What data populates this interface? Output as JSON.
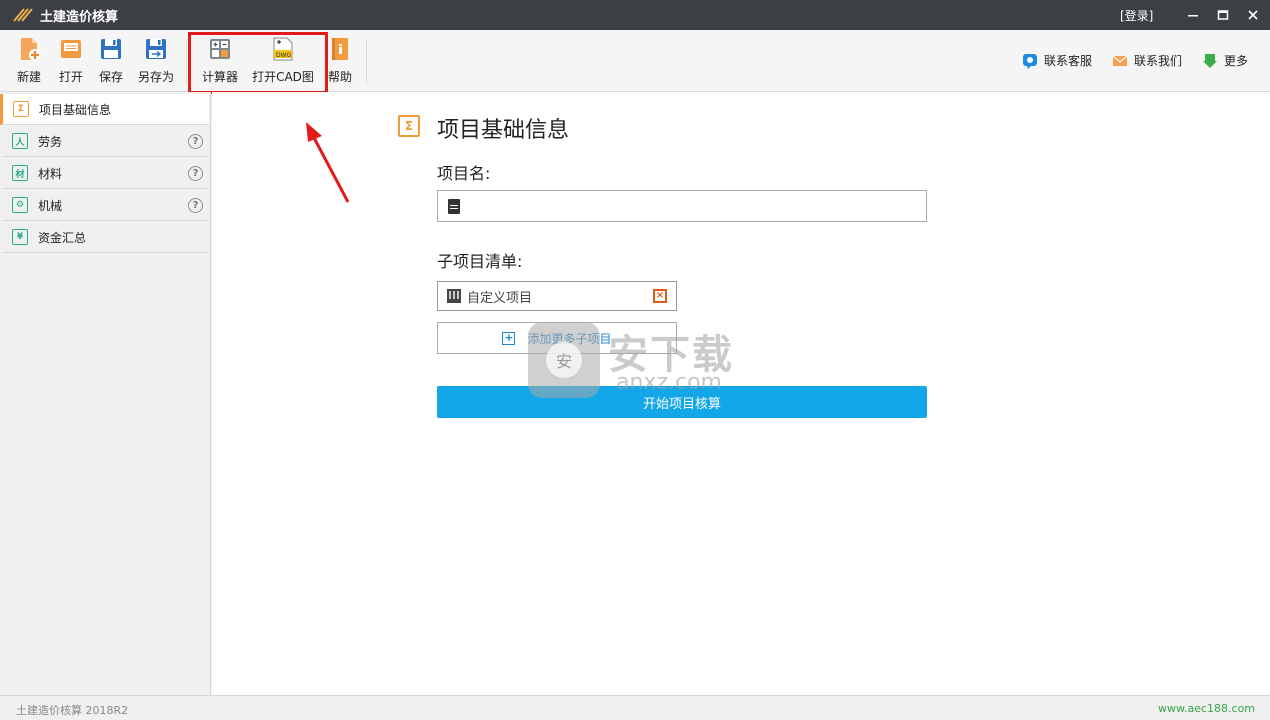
{
  "window": {
    "title": "土建造价核算",
    "login": "[登录]",
    "minimize": "—",
    "maximize": "▭",
    "close": "✕"
  },
  "toolbar": {
    "new_label": "新建",
    "open_label": "打开",
    "save_label": "保存",
    "save_as_label": "另存为",
    "calculator_label": "计算器",
    "open_cad_label": "打开CAD图",
    "cad_icon_text": "DWG",
    "help_label": "帮助",
    "contact_service_label": "联系客服",
    "contact_us_label": "联系我们",
    "more_label": "更多"
  },
  "sidebar": {
    "items": [
      {
        "label": "项目基础信息",
        "icon": "Σ"
      },
      {
        "label": "劳务",
        "icon": "人"
      },
      {
        "label": "材料",
        "icon": "材"
      },
      {
        "label": "机械",
        "icon": "⚙"
      },
      {
        "label": "资金汇总",
        "icon": "¥"
      }
    ],
    "help_glyph": "?"
  },
  "main": {
    "section_icon": "Σ",
    "title": "项目基础信息",
    "project_name_label": "项目名:",
    "project_name_value": "",
    "subitems_label": "子项目清单:",
    "subitems": [
      "自定义项目"
    ],
    "remove_glyph": "×",
    "add_more_label": "添加更多子项目",
    "add_glyph": "+",
    "start_button_label": "开始项目核算"
  },
  "watermark": {
    "shield_text": "安",
    "text": "安下载",
    "sub": "anxz.com"
  },
  "status": {
    "left": "土建造价核算 2018R2",
    "right": "www.aec188.com"
  },
  "colors": {
    "accent_orange": "#f29b3a",
    "primary_blue": "#13a6e8",
    "highlight_red": "#e21b1b",
    "titlebar": "#3c3f44"
  }
}
